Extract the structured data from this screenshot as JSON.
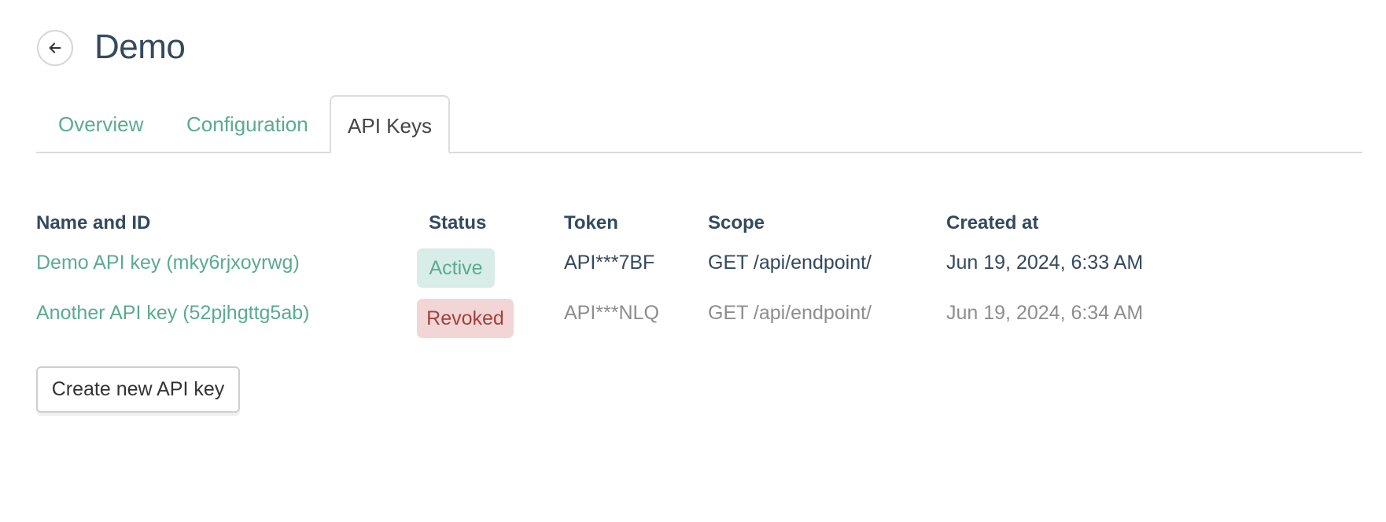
{
  "header": {
    "title": "Demo",
    "back_icon": "arrow-left-icon"
  },
  "tabs": [
    {
      "label": "Overview",
      "active": false
    },
    {
      "label": "Configuration",
      "active": false
    },
    {
      "label": "API Keys",
      "active": true
    }
  ],
  "table": {
    "columns": [
      "Name and ID",
      "Status",
      "Token",
      "Scope",
      "Created at"
    ],
    "rows": [
      {
        "name": "Demo API key (mky6rjxoyrwg)",
        "status": "Active",
        "token": "API***7BF",
        "scope": "GET /api/endpoint/",
        "created_at": "Jun 19, 2024, 6:33 AM"
      },
      {
        "name": "Another API key (52pjhgttg5ab)",
        "status": "Revoked",
        "token": "API***NLQ",
        "scope": "GET /api/endpoint/",
        "created_at": "Jun 19, 2024, 6:34 AM"
      }
    ]
  },
  "actions": {
    "create_label": "Create new API key"
  },
  "colors": {
    "accent": "#5aab8f",
    "heading": "#34495e",
    "active_bg": "#d8ede7",
    "revoked_bg": "#f2d6d6",
    "revoked_text": "#a2413f",
    "muted_text": "#8e8e8e"
  }
}
